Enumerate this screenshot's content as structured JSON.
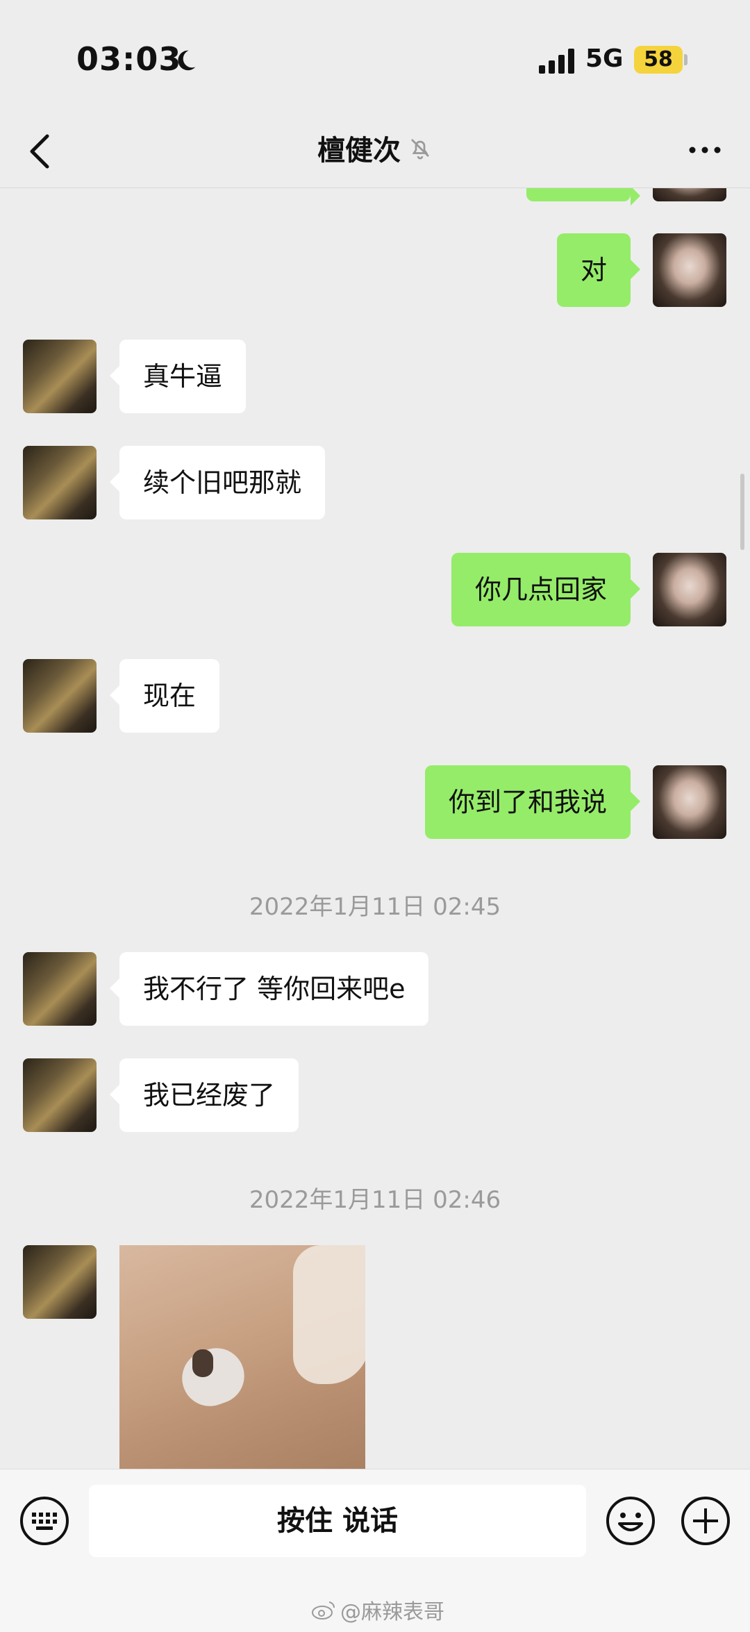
{
  "status_bar": {
    "time": "03:03",
    "network": "5G",
    "battery": "58"
  },
  "header": {
    "title": "檀健次"
  },
  "messages": [
    {
      "side": "out",
      "text": "对"
    },
    {
      "side": "in",
      "text": "真牛逼"
    },
    {
      "side": "in",
      "text": "续个旧吧那就"
    },
    {
      "side": "out",
      "text": "你几点回家"
    },
    {
      "side": "in",
      "text": "现在"
    },
    {
      "side": "out",
      "text": "你到了和我说"
    },
    {
      "type": "timestamp",
      "text": "2022年1月11日 02:45"
    },
    {
      "side": "in",
      "text": "我不行了 等你回来吧e"
    },
    {
      "side": "in",
      "text": "我已经废了"
    },
    {
      "type": "timestamp",
      "text": "2022年1月11日 02:46"
    },
    {
      "side": "in",
      "type": "image"
    }
  ],
  "input_bar": {
    "voice_label": "按住 说话"
  },
  "watermark": {
    "text": "@麻辣表哥"
  },
  "colors": {
    "outgoing_bubble": "#95ec69",
    "incoming_bubble": "#ffffff",
    "background": "#ededed",
    "battery": "#f5d33c"
  },
  "icons": [
    "moon-icon",
    "signal-icon",
    "back-icon",
    "mute-bell-icon",
    "more-icon",
    "keyboard-icon",
    "emoji-icon",
    "plus-icon",
    "weibo-icon"
  ]
}
